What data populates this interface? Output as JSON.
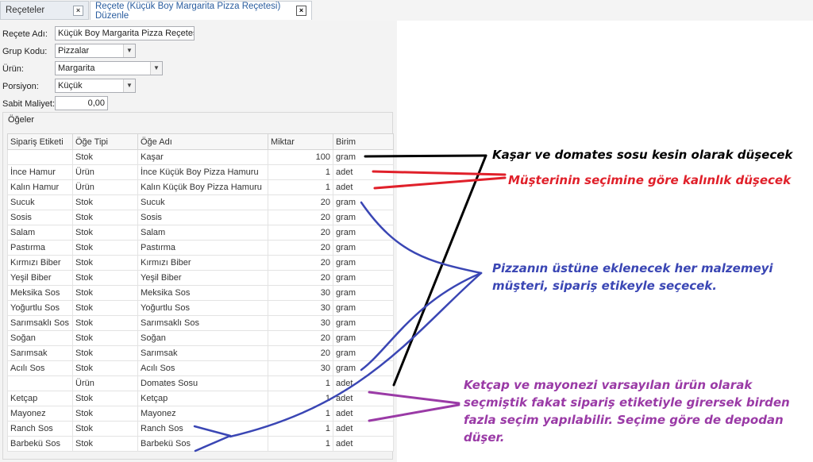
{
  "tabs": [
    {
      "label": "Reçeteler"
    },
    {
      "label": "Reçete (Küçük Boy Margarita Pizza Reçetesi) Düzenle"
    }
  ],
  "form": {
    "recete_adi_label": "Reçete Adı:",
    "recete_adi_value": "Küçük Boy Margarita Pizza Reçetesi",
    "grup_kodu_label": "Grup Kodu:",
    "grup_kodu_value": "Pizzalar",
    "urun_label": "Ürün:",
    "urun_value": "Margarita",
    "porsiyon_label": "Porsiyon:",
    "porsiyon_value": "Küçük",
    "sabit_maliyet_label": "Sabit Maliyet:",
    "sabit_maliyet_value": "0,00"
  },
  "items_group": {
    "title": "Öğeler",
    "columns": [
      "Sipariş Etiketi",
      "Öğe Tipi",
      "Öğe Adı",
      "Miktar",
      "Birim"
    ],
    "rows": [
      [
        "",
        "Stok",
        "Kaşar",
        "100",
        "gram"
      ],
      [
        "İnce Hamur",
        "Ürün",
        "İnce Küçük Boy Pizza Hamuru",
        "1",
        "adet"
      ],
      [
        "Kalın Hamur",
        "Ürün",
        "Kalın Küçük Boy Pizza Hamuru",
        "1",
        "adet"
      ],
      [
        "Sucuk",
        "Stok",
        "Sucuk",
        "20",
        "gram"
      ],
      [
        "Sosis",
        "Stok",
        "Sosis",
        "20",
        "gram"
      ],
      [
        "Salam",
        "Stok",
        "Salam",
        "20",
        "gram"
      ],
      [
        "Pastırma",
        "Stok",
        "Pastırma",
        "20",
        "gram"
      ],
      [
        "Kırmızı Biber",
        "Stok",
        "Kırmızı Biber",
        "20",
        "gram"
      ],
      [
        "Yeşil Biber",
        "Stok",
        "Yeşil Biber",
        "20",
        "gram"
      ],
      [
        "Meksika Sos",
        "Stok",
        "Meksika Sos",
        "30",
        "gram"
      ],
      [
        "Yoğurtlu Sos",
        "Stok",
        "Yoğurtlu Sos",
        "30",
        "gram"
      ],
      [
        "Sarımsaklı Sos",
        "Stok",
        "Sarımsaklı Sos",
        "30",
        "gram"
      ],
      [
        "Soğan",
        "Stok",
        "Soğan",
        "20",
        "gram"
      ],
      [
        "Sarımsak",
        "Stok",
        "Sarımsak",
        "20",
        "gram"
      ],
      [
        "Acılı Sos",
        "Stok",
        "Acılı Sos",
        "30",
        "gram"
      ],
      [
        "",
        "Ürün",
        "Domates Sosu",
        "1",
        "adet"
      ],
      [
        "Ketçap",
        "Stok",
        "Ketçap",
        "1",
        "adet"
      ],
      [
        "Mayonez",
        "Stok",
        "Mayonez",
        "1",
        "adet"
      ],
      [
        "Ranch Sos",
        "Stok",
        "Ranch Sos",
        "1",
        "adet"
      ],
      [
        "Barbekü Sos",
        "Stok",
        "Barbekü Sos",
        "1",
        "adet"
      ]
    ]
  },
  "annotations": {
    "black": {
      "text": "Kaşar ve domates sosu kesin olarak düşecek",
      "color": "#000000"
    },
    "red": {
      "text": "Müşterinin seçimine göre kalınlık düşecek",
      "color": "#e0202a"
    },
    "blue": {
      "lines": [
        "Pizzanın üstüne eklenecek her malzemeyi",
        "müşteri, sipariş etikeyle seçecek."
      ],
      "color": "#3a46b4"
    },
    "purple": {
      "lines": [
        "Ketçap ve mayonezi varsayılan ürün olarak",
        "seçmiştik fakat sipariş etiketiyle girersek birden",
        "fazla seçim yapılabilir. Seçime göre de depodan",
        "düşer."
      ],
      "color": "#9a3aa6"
    }
  }
}
